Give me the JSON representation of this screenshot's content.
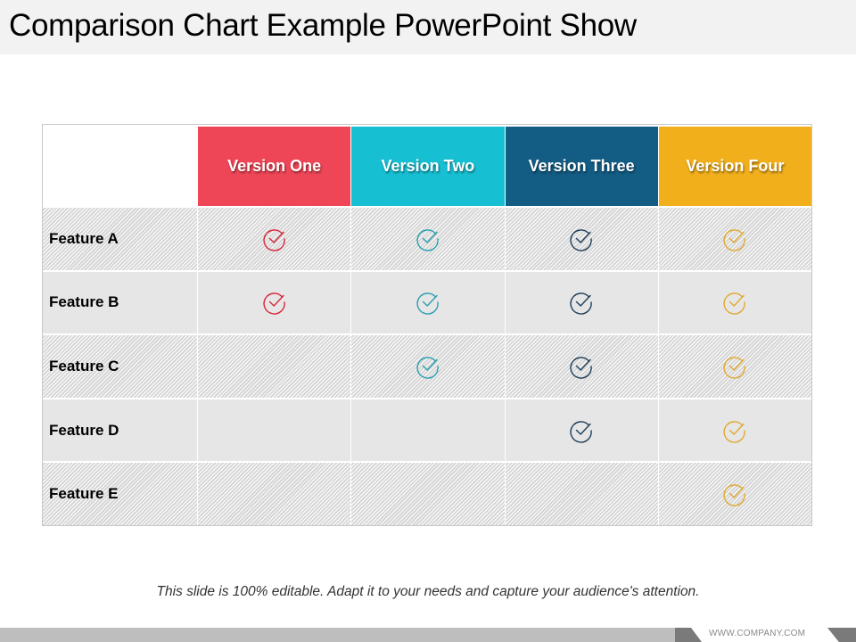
{
  "slide": {
    "title": "Comparison Chart Example PowerPoint Show",
    "caption": "This slide is 100% editable. Adapt it to your needs and capture your audience's attention.",
    "footer_url": "WWW.COMPANY.COM"
  },
  "table": {
    "columns": [
      {
        "label": "Version One",
        "color": "#ee4657"
      },
      {
        "label": "Version Two",
        "color": "#17bfd3"
      },
      {
        "label": "Version Three",
        "color": "#135c84"
      },
      {
        "label": "Version Four",
        "color": "#f1af1c"
      }
    ],
    "check_colors": [
      "#d8273b",
      "#2a9fb0",
      "#1e3f5a",
      "#e2a932"
    ],
    "check_icon": "circle-check-icon",
    "rows": [
      {
        "label": "Feature A",
        "checks": [
          true,
          true,
          true,
          true
        ]
      },
      {
        "label": "Feature B",
        "checks": [
          true,
          true,
          true,
          true
        ]
      },
      {
        "label": "Feature C",
        "checks": [
          false,
          true,
          true,
          true
        ]
      },
      {
        "label": "Feature D",
        "checks": [
          false,
          false,
          true,
          true
        ]
      },
      {
        "label": "Feature E",
        "checks": [
          false,
          false,
          false,
          true
        ]
      }
    ]
  }
}
